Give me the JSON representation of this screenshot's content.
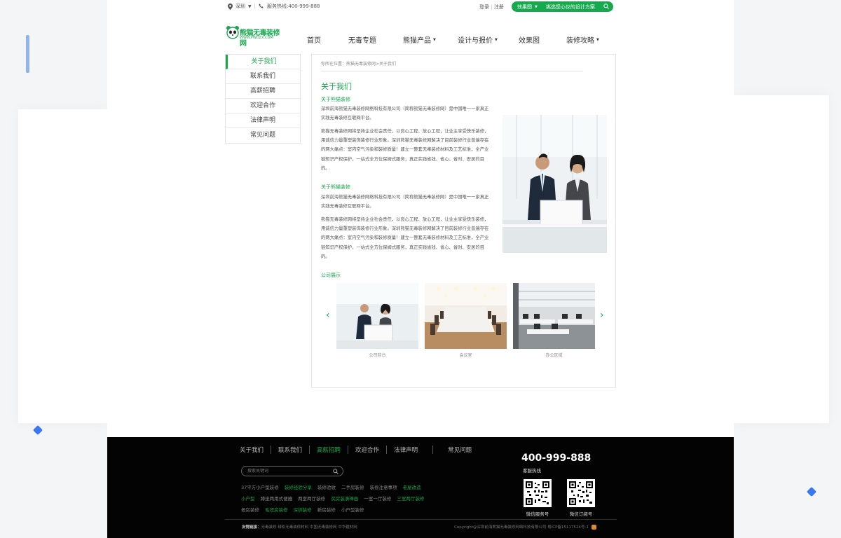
{
  "topbar": {
    "city": "深圳",
    "hotline_text": "服务热线:400-999-888",
    "login": "登录",
    "register": "注册",
    "effect_label": "效果图",
    "effect_prompt": "挑选您心仪的设计方案"
  },
  "logo": {
    "name": "熊猫无毒装修网",
    "url": "WWW.PWDZX.COM"
  },
  "nav": {
    "items": [
      {
        "label": "首页"
      },
      {
        "label": "无毒专题"
      },
      {
        "label": "熊猫产品"
      },
      {
        "label": "设计与报价"
      },
      {
        "label": "效果图"
      },
      {
        "label": "装修攻略"
      }
    ]
  },
  "sidebar": {
    "items": [
      {
        "label": "关于我们"
      },
      {
        "label": "联系我们"
      },
      {
        "label": "高薪招聘"
      },
      {
        "label": "欢迎合作"
      },
      {
        "label": "法律声明"
      },
      {
        "label": "常见问题"
      }
    ]
  },
  "content": {
    "breadcrumb": "你所在位置：熊猫无毒装修网>关于我们",
    "title": "关于我们",
    "section1_title": "关于熊猫装修",
    "section1_p1": "深圳前海熊猫无毒装修网络科技有限公司（简称熊猫无毒装修网）是中国唯一一家真正实践无毒装修互联网平台。",
    "section1_p2": "熊猫无毒装修网将坚持企业社会责任，以良心工程、放心工程，让业主享受快乐装修，用诚信力量重塑装饰装修行业形象。深圳熊猫无毒装修网解决了目前装修行业普遍存在的两大痛点：室内空气污染和装修质量！建立一整套无毒装修材料及工艺标准，全产业链知识产权保护，一站式全方位保姆式服务，真正实践省钱、省心、省时、安居的目的。",
    "section2_title": "关于熊猫装修",
    "section2_p1": "深圳前海熊猫无毒装修网络科技有限公司（简称熊猫无毒装修网）是中国唯一一家真正实践无毒装修互联网平台。",
    "section2_p2": "熊猫无毒装修网将坚持企业社会责任，以良心工程、放心工程，让业主享受快乐装修，用诚信力量重塑装饰装修行业形象。深圳熊猫无毒装修网解决了目前装修行业普遍存在的两大痛点：室内空气污染和装修质量！建立一整套无毒装修材料及工艺标准，全产业链知识产权保护，一站式全方位保姆式服务，真正实践省钱、省心、省时、安居的目的。",
    "gallery_title": "公司展示",
    "gallery": [
      {
        "caption": "公司前台"
      },
      {
        "caption": "会议室"
      },
      {
        "caption": "办公区域"
      }
    ]
  },
  "footer": {
    "nav": [
      {
        "label": "关于我们"
      },
      {
        "label": "联系我们"
      },
      {
        "label": "高薪招聘"
      },
      {
        "label": "欢迎合作"
      },
      {
        "label": "法律声明"
      },
      {
        "label": "常见问题"
      }
    ],
    "search_placeholder": "搜索关键词",
    "tags_row1": [
      "37平方小户型装修",
      "装修经验分享",
      "装修验收",
      "二手房装修",
      "装修注意事项",
      "老屋改造"
    ],
    "tags_row2": [
      "小户型",
      "蹲坐两用式便器",
      "两室两厅装修",
      "买房装潢禅画",
      "一室一厅装修",
      "三室两厅装修"
    ],
    "tags_row3": [
      "老房装修",
      "毛坯房装修",
      "深圳装修",
      "新房装修",
      "小户型装修"
    ],
    "hotline": "400-999-888",
    "hotline_label": "客服热线",
    "qr1_label": "微信服务号",
    "qr2_label": "微信订阅号",
    "friends_label": "友情链接：",
    "friends": "无毒装修 绿松无毒装修材料 中国无毒装修网 中华建材网",
    "copyright": "Copyright@深圳前海熊猫无毒装修网络科技有限公司  粤ICP备15117524号-1"
  },
  "colors": {
    "accent": "#18a84e",
    "footer_bg": "#030303"
  }
}
